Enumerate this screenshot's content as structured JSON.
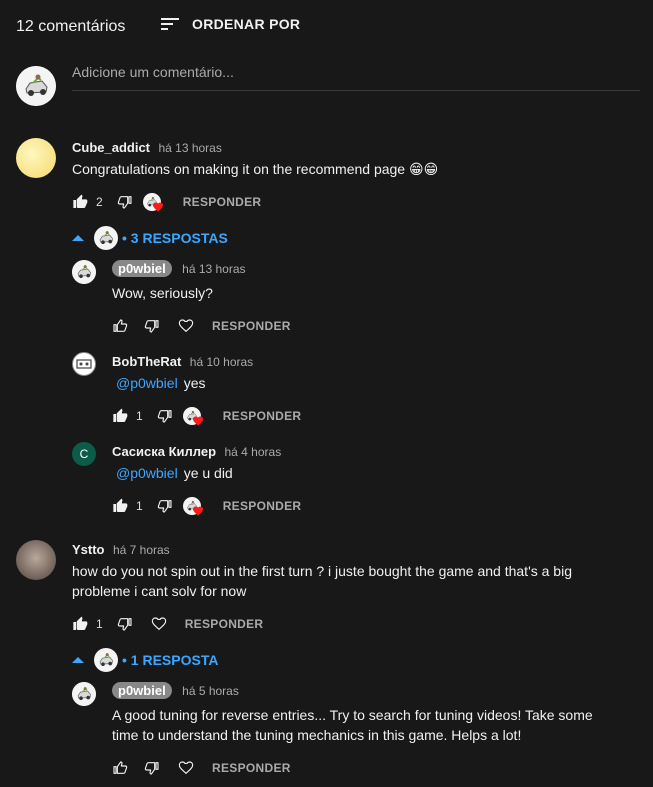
{
  "header": {
    "count_label": "12 comentários",
    "sort_label": "ORDENAR POR"
  },
  "add_comment": {
    "placeholder": "Adicione um comentário..."
  },
  "reply_label": "RESPONDER",
  "comments": [
    {
      "author": "Cube_addict",
      "time": "há 13 horas",
      "text": "Congratulations on making it on the recommend page 😁😁",
      "likes": "2",
      "replies_label": "• 3 RESPOSTAS",
      "replies": [
        {
          "author": "p0wbiel",
          "time": "há 13 horas",
          "text": "Wow, seriously?"
        },
        {
          "author": "BobTheRat",
          "time": "há 10 horas",
          "mention": "@p0wbiel",
          "text": "yes",
          "likes": "1"
        },
        {
          "author": "Сасиска Киллер",
          "time": "há 4 horas",
          "mention": "@p0wbiel",
          "text": "ye u did",
          "likes": "1",
          "avatar_letter": "C"
        }
      ]
    },
    {
      "author": "Ystto",
      "time": "há 7 horas",
      "text_line1": "how do you not spin out in the first turn ? i juste bought the game and that's a big",
      "text_line2": "probleme i cant solv for now",
      "likes": "1",
      "replies_label": "• 1 RESPOSTA",
      "replies": [
        {
          "author": "p0wbiel",
          "time": "há 5 horas",
          "text_line1": "A good tuning for reverse entries... Try to search for tuning videos! Take some",
          "text_line2": "time to understand the tuning mechanics in this game. Helps a lot!"
        }
      ]
    }
  ],
  "colors": {
    "background": "#181818",
    "link_blue": "#3ea6ff",
    "muted": "#aaaaaa",
    "heart": "#ff0000"
  }
}
